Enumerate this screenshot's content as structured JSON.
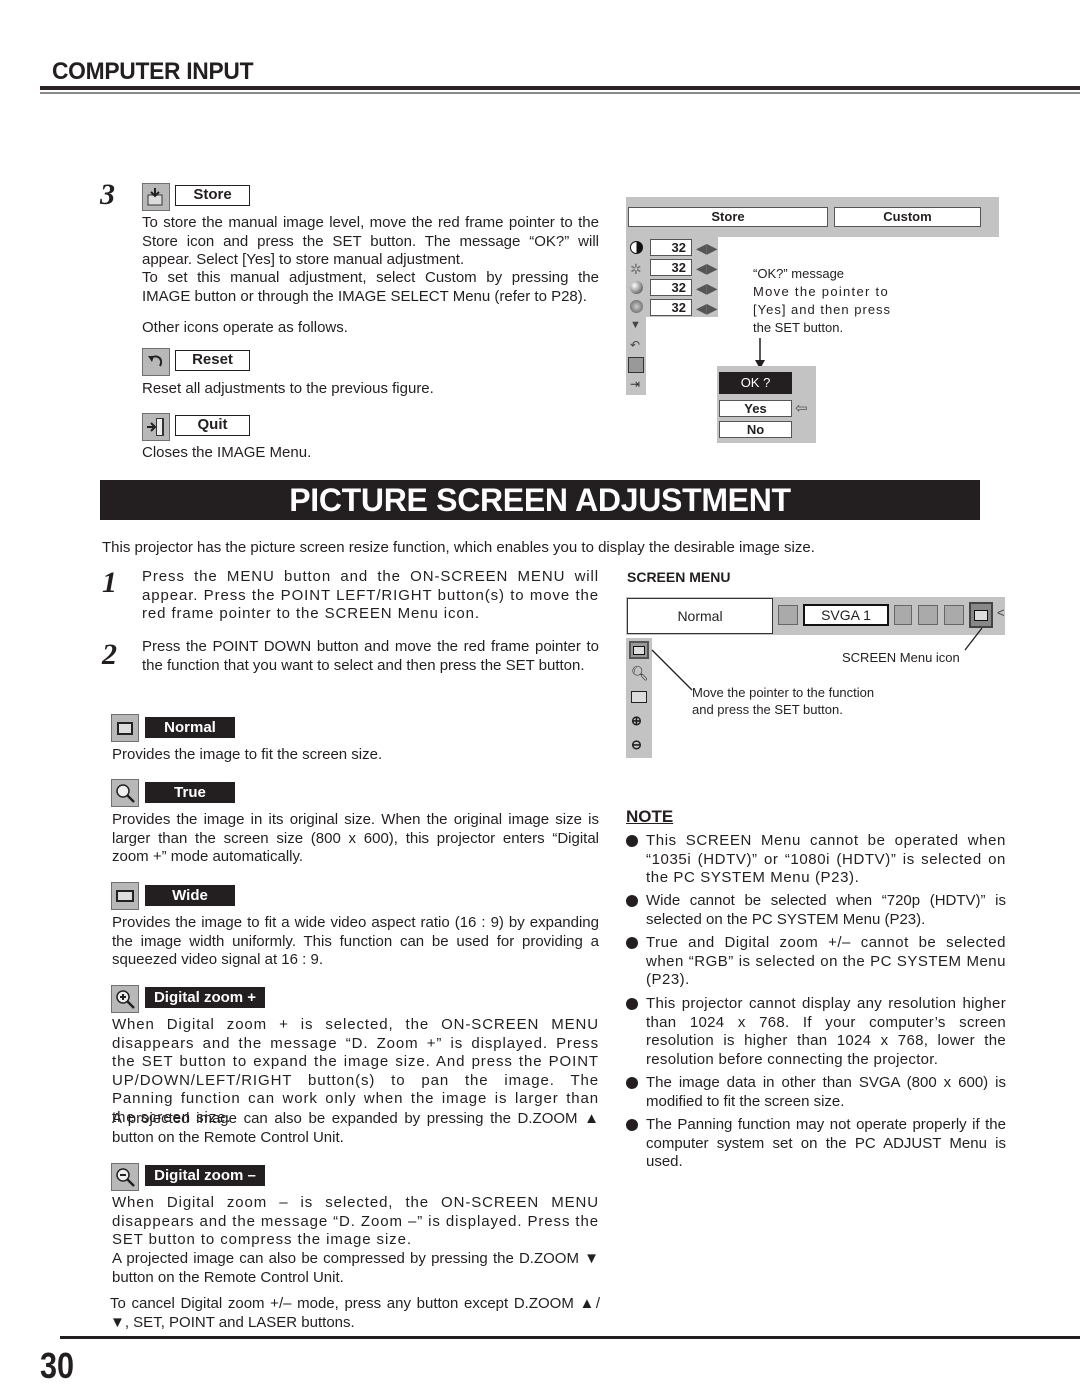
{
  "header": {
    "section_title": "COMPUTER INPUT"
  },
  "store_step": {
    "number": "3",
    "label": "Store",
    "paragraph1": "To store the manual image level, move the red frame pointer to the Store icon and press the SET button.  The message “OK?” will appear.  Select [Yes] to store manual adjustment.",
    "paragraph2": "To set this manual adjustment, select Custom by pressing the IMAGE button or through the IMAGE SELECT Menu (refer to P28).",
    "other_icons": "Other icons operate as follows."
  },
  "reset_item": {
    "label": "Reset",
    "description": "Reset all adjustments to the previous figure."
  },
  "quit_item": {
    "label": "Quit",
    "description": "Closes the IMAGE Menu."
  },
  "image_menu_figure": {
    "top_buttons": [
      "Store",
      "Custom"
    ],
    "rows": [
      {
        "icon": "contrast-icon",
        "value": "32"
      },
      {
        "icon": "brightness-icon",
        "value": "32"
      },
      {
        "icon": "color-icon",
        "value": "32"
      },
      {
        "icon": "tint-icon",
        "value": "32"
      }
    ],
    "extra_icons": [
      "down-arrow-icon",
      "reset-icon",
      "store-icon",
      "quit-icon"
    ],
    "callout": [
      "“OK?” message",
      "Move the pointer to",
      "[Yes] and then press",
      "the SET button."
    ],
    "dialog": {
      "title": "OK ?",
      "yes": "Yes",
      "no": "No"
    }
  },
  "banner": {
    "title": "PICTURE SCREEN ADJUSTMENT"
  },
  "intro": "This projector has the picture screen resize function, which enables you to display the desirable image size.",
  "steps": [
    {
      "number": "1",
      "text": "Press the MENU button and the ON-SCREEN MENU will appear.  Press the POINT LEFT/RIGHT button(s) to move the red frame pointer to the SCREEN Menu icon."
    },
    {
      "number": "2",
      "text": "Press the POINT DOWN button and move the red frame pointer to the function that you want to select and then press the SET button."
    }
  ],
  "functions": [
    {
      "label": "Normal",
      "icon": "normal-screen-icon",
      "description": "Provides the image to fit the screen size."
    },
    {
      "label": "True",
      "icon": "magnifier-icon",
      "description": "Provides the image in its original size.  When the original image size is larger than the screen size (800 x 600), this projector enters “Digital zoom +” mode automatically."
    },
    {
      "label": "Wide",
      "icon": "wide-screen-icon",
      "description": "Provides the image to fit a wide video aspect ratio (16 : 9) by expanding the image width uniformly.  This function can be used for providing a squeezed video signal at 16 : 9."
    },
    {
      "label": "Digital zoom +",
      "icon": "zoom-in-icon",
      "description": "When Digital zoom + is selected, the ON-SCREEN MENU disappears and the message “D. Zoom +” is displayed.  Press the SET button to expand the image size.  And press the POINT UP/DOWN/LEFT/RIGHT button(s) to pan the image.  The Panning function can work only when the image is larger than the screen size.",
      "description2": "A projected image can also be expanded by pressing the D.ZOOM ▲ button on the Remote Control Unit."
    },
    {
      "label": "Digital zoom –",
      "icon": "zoom-out-icon",
      "description": "When Digital zoom – is selected, the ON-SCREEN MENU disappears and the message “D. Zoom –” is displayed.  Press the SET button to compress the image size.",
      "description2": "A projected image can also be compressed by pressing the D.ZOOM ▼ button on the Remote Control Unit."
    }
  ],
  "cancel_note": "To cancel Digital zoom +/– mode, press any button except D.ZOOM ▲/▼, SET, POINT and LASER buttons.",
  "screen_menu_figure": {
    "title": "SCREEN MENU",
    "selected_function": "Normal",
    "source_label": "SVGA 1",
    "screen_icon_callout": "SCREEN Menu icon",
    "pointer_callout": [
      "Move the pointer to the function",
      "and press the SET button."
    ]
  },
  "note": {
    "title": "NOTE",
    "items": [
      "This SCREEN Menu cannot be operated when “1035i (HDTV)” or “1080i (HDTV)” is selected on the PC SYSTEM Menu  (P23).",
      "Wide cannot be selected when “720p (HDTV)” is selected on the PC SYSTEM Menu  (P23).",
      "True and Digital zoom +/– cannot be selected when “RGB” is selected on the PC SYSTEM Menu (P23).",
      "This projector cannot display any resolution higher than 1024 x 768.  If your computer’s screen resolution is higher than 1024 x 768, lower the resolution before connecting the projector.",
      "The image data in other than SVGA (800 x 600) is modified to fit the screen size.",
      "The Panning function may not operate properly if the computer system set on the PC ADJUST Menu is used."
    ]
  },
  "footer": {
    "page_number": "30"
  }
}
